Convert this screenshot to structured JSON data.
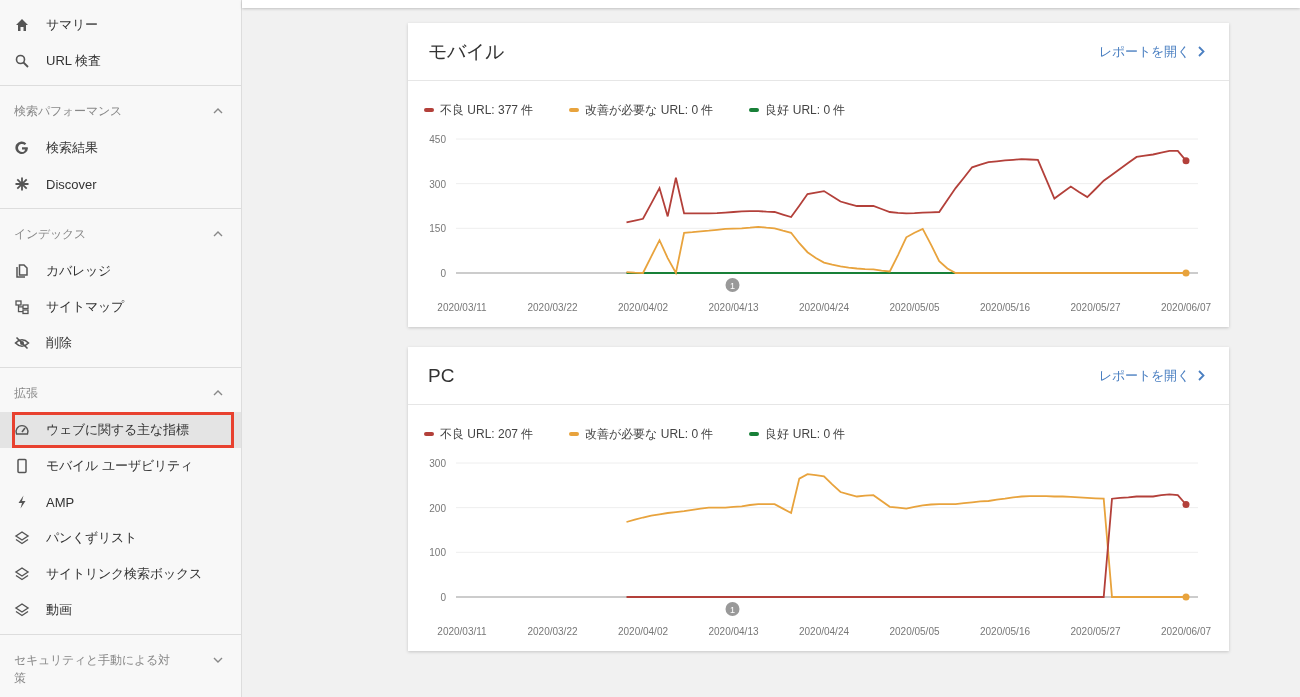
{
  "sidebar": {
    "sections": [
      {
        "items": [
          {
            "label": "サマリー",
            "selected": false,
            "outlined": false
          },
          {
            "label": "URL 検査",
            "selected": false,
            "outlined": false
          }
        ]
      },
      {
        "title": "検索パフォーマンス",
        "expanded": true,
        "items": [
          {
            "label": "検索結果",
            "selected": false,
            "outlined": false
          },
          {
            "label": "Discover",
            "selected": false,
            "outlined": false
          }
        ]
      },
      {
        "title": "インデックス",
        "expanded": true,
        "items": [
          {
            "label": "カバレッジ",
            "selected": false,
            "outlined": false
          },
          {
            "label": "サイトマップ",
            "selected": false,
            "outlined": false
          },
          {
            "label": "削除",
            "selected": false,
            "outlined": false
          }
        ]
      },
      {
        "title": "拡張",
        "expanded": true,
        "items": [
          {
            "label": "ウェブに関する主な指標",
            "selected": true,
            "outlined": true
          },
          {
            "label": "モバイル ユーザビリティ",
            "selected": false,
            "outlined": false
          },
          {
            "label": "AMP",
            "selected": false,
            "outlined": false
          },
          {
            "label": "パンくずリスト",
            "selected": false,
            "outlined": false
          },
          {
            "label": "サイトリンク検索ボックス",
            "selected": false,
            "outlined": false
          },
          {
            "label": "動画",
            "selected": false,
            "outlined": false
          }
        ]
      },
      {
        "title": "セキュリティと手動による対策",
        "expanded": false
      }
    ]
  },
  "cards": [
    {
      "title": "モバイル",
      "link": "レポートを開く",
      "chart_data": {
        "type": "line",
        "ylim": [
          0,
          450
        ],
        "yticks": [
          0,
          150,
          300,
          450
        ],
        "annotations": [
          "1"
        ],
        "categories": [
          "2020/03/11",
          null,
          null,
          null,
          null,
          null,
          null,
          null,
          null,
          null,
          null,
          "2020/03/22",
          null,
          null,
          null,
          null,
          null,
          null,
          null,
          null,
          null,
          null,
          "2020/04/02",
          null,
          null,
          null,
          null,
          null,
          null,
          null,
          null,
          null,
          null,
          "2020/04/13",
          null,
          null,
          null,
          null,
          null,
          null,
          null,
          null,
          null,
          null,
          "2020/04/24",
          null,
          null,
          null,
          null,
          null,
          null,
          null,
          null,
          null,
          null,
          "2020/05/05",
          null,
          null,
          null,
          null,
          null,
          null,
          null,
          null,
          null,
          null,
          "2020/05/16",
          null,
          null,
          null,
          null,
          null,
          null,
          null,
          null,
          null,
          null,
          "2020/05/27",
          null,
          null,
          null,
          null,
          null,
          null,
          null,
          null,
          null,
          null,
          "2020/06/07"
        ],
        "series": [
          {
            "name": "不良 URL: 377 件",
            "color": "#b3403a",
            "values": [
              null,
              null,
              null,
              null,
              null,
              null,
              null,
              null,
              null,
              null,
              null,
              null,
              null,
              null,
              null,
              null,
              null,
              null,
              null,
              null,
              170,
              176,
              182,
              233,
              285,
              190,
              320,
              200,
              200,
              200,
              200,
              201,
              203,
              205,
              207,
              208,
              208,
              206,
              205,
              196,
              188,
              226,
              265,
              270,
              275,
              258,
              240,
              232,
              225,
              225,
              225,
              215,
              205,
              202,
              200,
              201,
              203,
              204,
              205,
              245,
              285,
              320,
              355,
              364,
              372,
              375,
              378,
              380,
              382,
              381,
              380,
              315,
              250,
              270,
              290,
              272,
              255,
              282,
              310,
              330,
              350,
              370,
              390,
              394,
              398,
              404,
              410,
              410,
              377
            ]
          },
          {
            "name": "改善が必要な URL: 0 件",
            "color": "#e8a33d",
            "values": [
              null,
              null,
              null,
              null,
              null,
              null,
              null,
              null,
              null,
              null,
              null,
              null,
              null,
              null,
              null,
              null,
              null,
              null,
              null,
              null,
              3,
              1,
              0,
              55,
              110,
              50,
              0,
              135,
              137,
              140,
              142,
              145,
              148,
              149,
              150,
              152,
              155,
              152,
              150,
              142,
              135,
              100,
              70,
              50,
              35,
              28,
              22,
              18,
              15,
              13,
              12,
              8,
              5,
              60,
              120,
              135,
              148,
              95,
              40,
              15,
              0,
              0,
              0,
              0,
              0,
              0,
              0,
              0,
              0,
              0,
              0,
              0,
              0,
              0,
              0,
              0,
              0,
              0,
              0,
              0,
              0,
              0,
              0,
              0,
              0,
              0,
              0,
              0,
              0
            ]
          },
          {
            "name": "良好 URL: 0 件",
            "color": "#188038",
            "values": [
              null,
              null,
              null,
              null,
              null,
              null,
              null,
              null,
              null,
              null,
              null,
              null,
              null,
              null,
              null,
              null,
              null,
              null,
              null,
              null,
              0,
              0,
              0,
              0,
              0,
              0,
              0,
              0,
              0,
              0,
              0,
              0,
              0,
              0,
              0,
              0,
              0,
              0,
              0,
              0,
              0,
              0,
              0,
              0,
              0,
              0,
              0,
              0,
              0,
              0,
              0,
              0,
              0,
              0,
              0,
              0,
              0,
              0,
              0,
              0,
              0,
              null,
              null,
              null,
              null,
              null,
              null,
              null,
              null,
              null,
              null,
              null,
              null,
              null,
              null,
              null,
              null,
              null,
              null,
              null,
              null,
              null,
              null,
              null,
              null,
              null,
              null,
              null,
              null
            ]
          }
        ]
      }
    },
    {
      "title": "PC",
      "link": "レポートを開く",
      "chart_data": {
        "type": "line",
        "ylim": [
          0,
          300
        ],
        "yticks": [
          0,
          100,
          200,
          300
        ],
        "annotations": [
          "1"
        ],
        "categories": [
          "2020/03/11",
          null,
          null,
          null,
          null,
          null,
          null,
          null,
          null,
          null,
          null,
          "2020/03/22",
          null,
          null,
          null,
          null,
          null,
          null,
          null,
          null,
          null,
          null,
          "2020/04/02",
          null,
          null,
          null,
          null,
          null,
          null,
          null,
          null,
          null,
          null,
          "2020/04/13",
          null,
          null,
          null,
          null,
          null,
          null,
          null,
          null,
          null,
          null,
          "2020/04/24",
          null,
          null,
          null,
          null,
          null,
          null,
          null,
          null,
          null,
          null,
          "2020/05/05",
          null,
          null,
          null,
          null,
          null,
          null,
          null,
          null,
          null,
          null,
          "2020/05/16",
          null,
          null,
          null,
          null,
          null,
          null,
          null,
          null,
          null,
          null,
          "2020/05/27",
          null,
          null,
          null,
          null,
          null,
          null,
          null,
          null,
          null,
          null,
          "2020/06/07"
        ],
        "series": [
          {
            "name": "不良 URL: 207 件",
            "color": "#b3403a",
            "values": [
              null,
              null,
              null,
              null,
              null,
              null,
              null,
              null,
              null,
              null,
              null,
              null,
              null,
              null,
              null,
              null,
              null,
              null,
              null,
              null,
              0,
              0,
              0,
              0,
              0,
              0,
              0,
              0,
              0,
              0,
              0,
              0,
              0,
              0,
              0,
              0,
              0,
              0,
              0,
              0,
              0,
              0,
              0,
              0,
              0,
              0,
              0,
              0,
              0,
              0,
              0,
              0,
              0,
              0,
              0,
              0,
              0,
              0,
              0,
              0,
              0,
              0,
              0,
              0,
              0,
              0,
              0,
              0,
              0,
              0,
              0,
              0,
              0,
              0,
              0,
              0,
              0,
              0,
              0,
              220,
              222,
              223,
              225,
              225,
              225,
              228,
              230,
              228,
              207
            ]
          },
          {
            "name": "改善が必要な URL: 0 件",
            "color": "#e8a33d",
            "values": [
              null,
              null,
              null,
              null,
              null,
              null,
              null,
              null,
              null,
              null,
              null,
              null,
              null,
              null,
              null,
              null,
              null,
              null,
              null,
              null,
              168,
              173,
              178,
              182,
              185,
              188,
              190,
              192,
              195,
              198,
              200,
              200,
              200,
              202,
              203,
              206,
              208,
              208,
              208,
              198,
              188,
              265,
              275,
              273,
              270,
              252,
              235,
              230,
              225,
              227,
              228,
              215,
              202,
              200,
              198,
              202,
              205,
              207,
              208,
              208,
              208,
              210,
              212,
              214,
              215,
              218,
              220,
              223,
              225,
              226,
              226,
              226,
              225,
              225,
              224,
              223,
              222,
              221,
              220,
              0,
              0,
              0,
              0,
              0,
              0,
              0,
              0,
              0,
              0
            ]
          },
          {
            "name": "良好 URL: 0 件",
            "color": "#188038",
            "values": [
              null,
              null,
              null,
              null,
              null,
              null,
              null,
              null,
              null,
              null,
              null,
              null,
              null,
              null,
              null,
              null,
              null,
              null,
              null,
              null,
              null,
              null,
              null,
              null,
              null,
              null,
              null,
              null,
              null,
              null,
              null,
              null,
              null,
              null,
              null,
              null,
              null,
              null,
              null,
              null,
              null,
              null,
              null,
              null,
              null,
              null,
              null,
              null,
              null,
              null,
              null,
              null,
              null,
              null,
              null,
              null,
              null,
              null,
              null,
              null,
              null,
              null,
              null,
              null,
              null,
              null,
              null,
              null,
              null,
              null,
              null,
              null,
              null,
              null,
              null,
              null,
              null,
              null,
              null,
              null,
              null,
              null,
              null,
              null,
              null,
              null,
              null,
              null,
              null
            ]
          }
        ]
      }
    }
  ]
}
